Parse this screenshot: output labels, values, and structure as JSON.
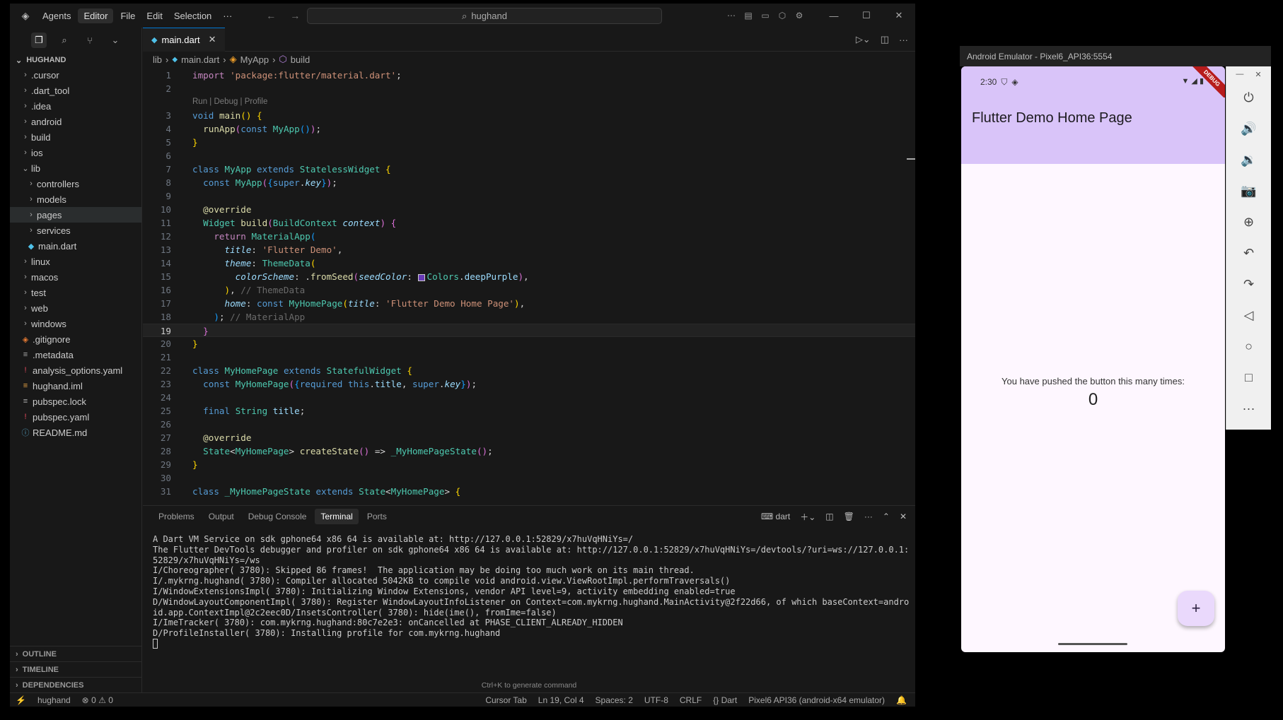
{
  "titlebar": {
    "tabs": [
      "Agents",
      "Editor"
    ],
    "menus": [
      "File",
      "Edit",
      "Selection",
      "···"
    ],
    "search_text": "hughand"
  },
  "sidebar": {
    "root": "HUGHAND",
    "items": [
      {
        "label": ".cursor",
        "type": "folder",
        "depth": 0
      },
      {
        "label": ".dart_tool",
        "type": "folder",
        "depth": 0
      },
      {
        "label": ".idea",
        "type": "folder",
        "depth": 0
      },
      {
        "label": "android",
        "type": "folder",
        "depth": 0
      },
      {
        "label": "build",
        "type": "folder",
        "depth": 0
      },
      {
        "label": "ios",
        "type": "folder",
        "depth": 0
      },
      {
        "label": "lib",
        "type": "folder-open",
        "depth": 0
      },
      {
        "label": "controllers",
        "type": "folder",
        "depth": 1
      },
      {
        "label": "models",
        "type": "folder",
        "depth": 1
      },
      {
        "label": "pages",
        "type": "folder",
        "depth": 1,
        "selected": true
      },
      {
        "label": "services",
        "type": "folder",
        "depth": 1
      },
      {
        "label": "main.dart",
        "type": "dart",
        "depth": 1
      },
      {
        "label": "linux",
        "type": "folder",
        "depth": 0
      },
      {
        "label": "macos",
        "type": "folder",
        "depth": 0
      },
      {
        "label": "test",
        "type": "folder",
        "depth": 0
      },
      {
        "label": "web",
        "type": "folder",
        "depth": 0
      },
      {
        "label": "windows",
        "type": "folder",
        "depth": 0
      },
      {
        "label": ".gitignore",
        "type": "git",
        "depth": 0
      },
      {
        "label": ".metadata",
        "type": "text",
        "depth": 0
      },
      {
        "label": "analysis_options.yaml",
        "type": "yaml",
        "depth": 0
      },
      {
        "label": "hughand.iml",
        "type": "iml",
        "depth": 0
      },
      {
        "label": "pubspec.lock",
        "type": "text",
        "depth": 0
      },
      {
        "label": "pubspec.yaml",
        "type": "yaml",
        "depth": 0
      },
      {
        "label": "README.md",
        "type": "info",
        "depth": 0
      }
    ],
    "sections": [
      "OUTLINE",
      "TIMELINE",
      "DEPENDENCIES"
    ]
  },
  "editor": {
    "tab": "main.dart",
    "breadcrumbs": [
      "lib",
      "main.dart",
      "MyApp",
      "build"
    ],
    "codelens": "Run | Debug | Profile",
    "cursor_line": 19
  },
  "panel": {
    "tabs": [
      "Problems",
      "Output",
      "Debug Console",
      "Terminal",
      "Ports"
    ],
    "active_tab": "Terminal",
    "terminal_name": "dart",
    "lines": [
      "A Dart VM Service on sdk gphone64 x86 64 is available at: http://127.0.0.1:52829/x7huVqHNiYs=/",
      "The Flutter DevTools debugger and profiler on sdk gphone64 x86 64 is available at: http://127.0.0.1:52829/x7huVqHNiYs=/devtools/?uri=ws://127.0.0.1:52829/x7huVqHNiYs=/ws",
      "I/Choreographer( 3780): Skipped 86 frames!  The application may be doing too much work on its main thread.",
      "I/.mykrng.hughand( 3780): Compiler allocated 5042KB to compile void android.view.ViewRootImpl.performTraversals()",
      "I/WindowExtensionsImpl( 3780): Initializing Window Extensions, vendor API level=9, activity embedding enabled=true",
      "D/WindowLayoutComponentImpl( 3780): Register WindowLayoutInfoListener on Context=com.mykrng.hughand.MainActivity@2f22d66, of which baseContext=android.app.ContextImpl@2c2eec0D/InsetsController( 3780): hide(ime(), fromIme=false)",
      "I/ImeTracker( 3780): com.mykrng.hughand:80c7e2e3: onCancelled at PHASE_CLIENT_ALREADY_HIDDEN",
      "D/ProfileInstaller( 3780): Installing profile for com.mykrng.hughand"
    ],
    "hint": "Ctrl+K to generate command"
  },
  "statusbar": {
    "branch": "hughand",
    "errors": "0",
    "warnings": "0",
    "items": [
      "Cursor Tab",
      "Ln 19, Col 4",
      "Spaces: 2",
      "UTF-8",
      "CRLF",
      "{} Dart",
      "Pixel6 API36 (android-x64 emulator)"
    ]
  },
  "emulator": {
    "title": "Android Emulator - Pixel6_API36:5554",
    "time": "2:30",
    "debug_label": "DEBUG",
    "app_title": "Flutter Demo Home Page",
    "counter_label": "You have pushed the button this many times:",
    "counter_value": "0",
    "fab_label": "+",
    "controls": [
      "power-icon",
      "volume-up-icon",
      "volume-down-icon",
      "camera-icon",
      "zoom-icon",
      "rotate-left-icon",
      "rotate-right-icon",
      "back-icon",
      "home-icon",
      "overview-icon",
      "more-icon"
    ]
  },
  "colors": {
    "accent": "#0078d4",
    "app_bar": "#d9c4f9",
    "app_bg": "#fef7ff",
    "deep_purple_swatch": "#673ab7"
  }
}
